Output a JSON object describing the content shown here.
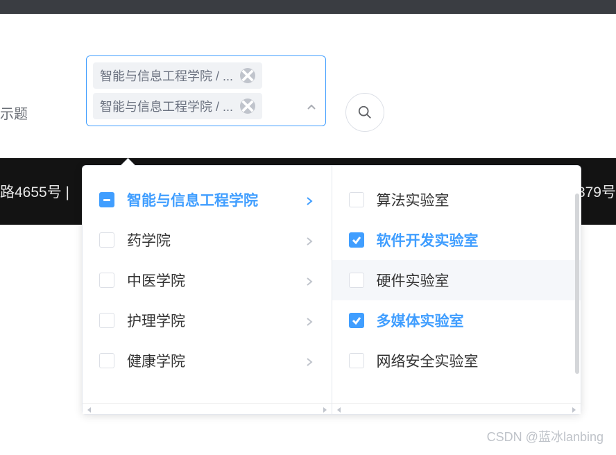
{
  "partial_input_label": "示题",
  "tags": [
    {
      "label": "智能与信息工程学院 / ..."
    },
    {
      "label": "智能与信息工程学院 / ..."
    }
  ],
  "dark_band": {
    "left": "路4655号 |",
    "right": "379号"
  },
  "panel1": [
    {
      "label": "智能与信息工程学院",
      "state": "indeterminate",
      "active": true
    },
    {
      "label": "药学院",
      "state": "unchecked"
    },
    {
      "label": "中医学院",
      "state": "unchecked"
    },
    {
      "label": "护理学院",
      "state": "unchecked"
    },
    {
      "label": "健康学院",
      "state": "unchecked"
    }
  ],
  "panel2": [
    {
      "label": "算法实验室",
      "state": "unchecked"
    },
    {
      "label": "软件开发实验室",
      "state": "checked",
      "active": true
    },
    {
      "label": "硬件实验室",
      "state": "unchecked",
      "hover": true
    },
    {
      "label": "多媒体实验室",
      "state": "checked",
      "active": true
    },
    {
      "label": "网络安全实验室",
      "state": "unchecked"
    }
  ],
  "watermark": "CSDN @蓝冰lanbing"
}
